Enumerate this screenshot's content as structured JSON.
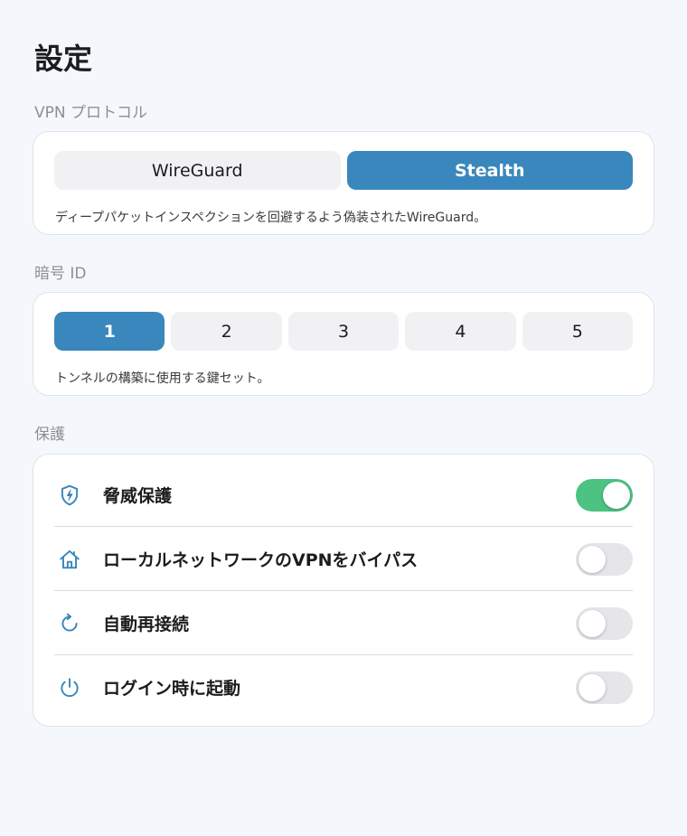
{
  "page": {
    "title": "設定"
  },
  "protocol": {
    "section_label": "VPN プロトコル",
    "options": [
      "WireGuard",
      "Stealth"
    ],
    "selected": "Stealth",
    "description": "ディープパケットインスペクションを回避するよう偽装されたWireGuard。"
  },
  "cipher": {
    "section_label": "暗号 ID",
    "options": [
      "1",
      "2",
      "3",
      "4",
      "5"
    ],
    "selected": "1",
    "description": "トンネルの構築に使用する鍵セット。"
  },
  "protection": {
    "section_label": "保護",
    "items": [
      {
        "label": "脅威保護",
        "icon": "shield-bolt-icon",
        "enabled": true
      },
      {
        "label": "ローカルネットワークのVPNをバイパス",
        "icon": "home-icon",
        "enabled": false
      },
      {
        "label": "自動再接続",
        "icon": "refresh-icon",
        "enabled": false
      },
      {
        "label": "ログイン時に起動",
        "icon": "power-icon",
        "enabled": false
      }
    ]
  },
  "colors": {
    "accent": "#3a87bd",
    "toggle_on": "#4cc283",
    "toggle_off": "#e5e5ea",
    "background": "#f4f8fc"
  }
}
